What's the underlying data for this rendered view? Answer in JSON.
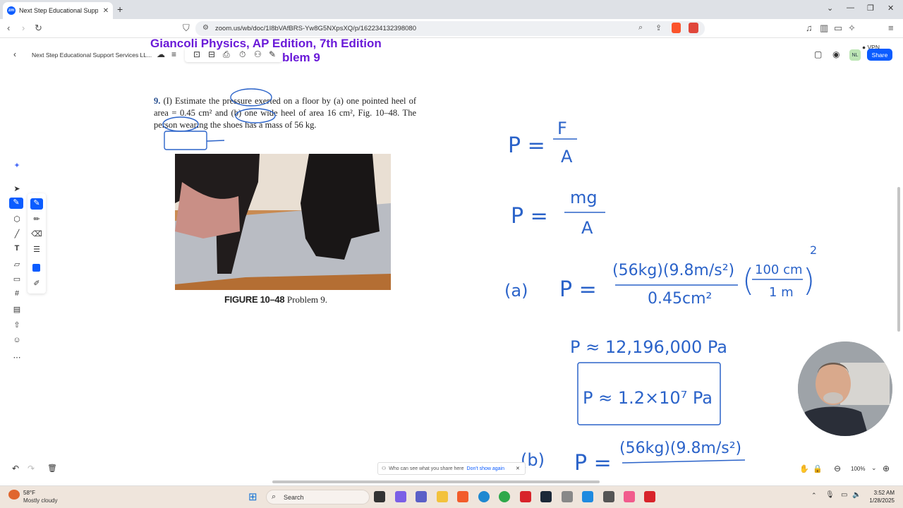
{
  "browser": {
    "tab_title": "Next Step Educational Support",
    "url": "zoom.us/wb/doc/1I8bVAfBRS-Yw8G5NXpsXQ/p/162234132398080",
    "vpn_label": "VPN"
  },
  "zoom_toolbar": {
    "doc_title": "Next Step Educational Support Services LL...",
    "avatar_initials": "NL",
    "share_label": "Share"
  },
  "heading": {
    "line1": "Giancoli Physics, AP Edition, 7th Edition",
    "line2": "blem 9"
  },
  "problem": {
    "number": "9.",
    "text": "(I) Estimate the pressure exerted on a floor by (a) one pointed heel of area = 0.45 cm² and (b) one wide heel of area 16 cm², Fig. 10–48. The person wearing the shoes has a mass of 56 kg.",
    "figure_label": "FIGURE 10–48",
    "figure_caption": "Problem 9."
  },
  "handwriting": {
    "eq1_left": "P =",
    "eq1_num": "F",
    "eq1_den": "A",
    "eq2_left": "P =",
    "eq2_num": "mg",
    "eq2_den": "A",
    "part_a_label": "(a)",
    "part_a_left": "P =",
    "part_a_num": "(56kg)(9.8m/s²)",
    "part_a_den": "0.45cm²",
    "part_a_conv_num": "100 cm",
    "part_a_conv_den": "1 m",
    "part_a_conv_exp": "2",
    "result_a": "P ≈ 12,196,000 Pa",
    "result_a_boxed": "P ≈ 1.2×10⁷ Pa",
    "part_b_label": "(b)",
    "part_b_left": "P =",
    "part_b_num": "(56kg)(9.8m/s²)"
  },
  "notice": {
    "text": "Who can see what you share here",
    "link": "Don't show again"
  },
  "zoom_level": "100%",
  "taskbar": {
    "weather_temp": "58°F",
    "weather_desc": "Mostly cloudy",
    "search_placeholder": "Search",
    "time": "3:52 AM",
    "date": "1/28/2025"
  },
  "colors": {
    "ink": "#2b63c9",
    "heading": "#6a1ad8",
    "accent": "#0b5cff"
  }
}
